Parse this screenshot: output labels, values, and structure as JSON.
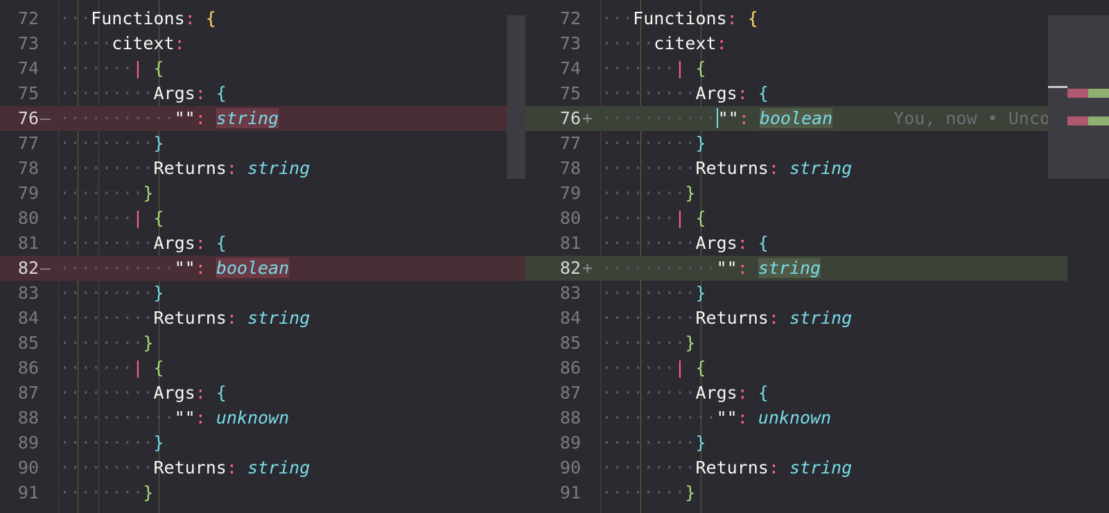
{
  "left": {
    "lines": [
      {
        "n": "72",
        "m": "",
        "d": "···",
        "parts": [
          [
            "k",
            "Functions"
          ],
          [
            "p",
            ": "
          ],
          [
            "y",
            "{"
          ]
        ]
      },
      {
        "n": "73",
        "m": "",
        "d": "·····",
        "parts": [
          [
            "k",
            "citext"
          ],
          [
            "p",
            ":"
          ]
        ]
      },
      {
        "n": "74",
        "m": "",
        "d": "·······",
        "parts": [
          [
            "bar",
            "| "
          ],
          [
            "g",
            "{"
          ]
        ]
      },
      {
        "n": "75",
        "m": "",
        "d": "·········",
        "parts": [
          [
            "k",
            "Args"
          ],
          [
            "p",
            ": "
          ],
          [
            "c",
            "{"
          ]
        ]
      },
      {
        "n": "76",
        "m": "—",
        "d": "···········",
        "bg": "del",
        "parts": [
          [
            "k",
            "\"\""
          ],
          [
            "p",
            ": "
          ],
          [
            "tw",
            "string"
          ]
        ]
      },
      {
        "n": "77",
        "m": "",
        "d": "·········",
        "parts": [
          [
            "c",
            "}"
          ]
        ]
      },
      {
        "n": "78",
        "m": "",
        "d": "·········",
        "parts": [
          [
            "k",
            "Returns"
          ],
          [
            "p",
            ": "
          ],
          [
            "t",
            "string"
          ]
        ]
      },
      {
        "n": "79",
        "m": "",
        "d": "········",
        "parts": [
          [
            "g",
            "}"
          ]
        ]
      },
      {
        "n": "80",
        "m": "",
        "d": "·······",
        "parts": [
          [
            "bar",
            "| "
          ],
          [
            "g",
            "{"
          ]
        ]
      },
      {
        "n": "81",
        "m": "",
        "d": "·········",
        "parts": [
          [
            "k",
            "Args"
          ],
          [
            "p",
            ": "
          ],
          [
            "c",
            "{"
          ]
        ]
      },
      {
        "n": "82",
        "m": "—",
        "d": "···········",
        "bg": "del",
        "parts": [
          [
            "k",
            "\"\""
          ],
          [
            "p",
            ": "
          ],
          [
            "tw",
            "boolean"
          ]
        ]
      },
      {
        "n": "83",
        "m": "",
        "d": "·········",
        "parts": [
          [
            "c",
            "}"
          ]
        ]
      },
      {
        "n": "84",
        "m": "",
        "d": "·········",
        "parts": [
          [
            "k",
            "Returns"
          ],
          [
            "p",
            ": "
          ],
          [
            "t",
            "string"
          ]
        ]
      },
      {
        "n": "85",
        "m": "",
        "d": "········",
        "parts": [
          [
            "g",
            "}"
          ]
        ]
      },
      {
        "n": "86",
        "m": "",
        "d": "·······",
        "parts": [
          [
            "bar",
            "| "
          ],
          [
            "g",
            "{"
          ]
        ]
      },
      {
        "n": "87",
        "m": "",
        "d": "·········",
        "parts": [
          [
            "k",
            "Args"
          ],
          [
            "p",
            ": "
          ],
          [
            "c",
            "{"
          ]
        ]
      },
      {
        "n": "88",
        "m": "",
        "d": "···········",
        "parts": [
          [
            "k",
            "\"\""
          ],
          [
            "p",
            ": "
          ],
          [
            "t",
            "unknown"
          ]
        ]
      },
      {
        "n": "89",
        "m": "",
        "d": "·········",
        "parts": [
          [
            "c",
            "}"
          ]
        ]
      },
      {
        "n": "90",
        "m": "",
        "d": "·········",
        "parts": [
          [
            "k",
            "Returns"
          ],
          [
            "p",
            ": "
          ],
          [
            "t",
            "string"
          ]
        ]
      },
      {
        "n": "91",
        "m": "",
        "d": "········",
        "parts": [
          [
            "g",
            "}"
          ]
        ]
      }
    ]
  },
  "right": {
    "lines": [
      {
        "n": "72",
        "m": "",
        "d": "···",
        "parts": [
          [
            "k",
            "Functions"
          ],
          [
            "p",
            ": "
          ],
          [
            "y",
            "{"
          ]
        ]
      },
      {
        "n": "73",
        "m": "",
        "d": "·····",
        "parts": [
          [
            "k",
            "citext"
          ],
          [
            "p",
            ":"
          ]
        ]
      },
      {
        "n": "74",
        "m": "",
        "d": "·······",
        "parts": [
          [
            "bar",
            "| "
          ],
          [
            "g",
            "{"
          ]
        ]
      },
      {
        "n": "75",
        "m": "",
        "d": "·········",
        "parts": [
          [
            "k",
            "Args"
          ],
          [
            "p",
            ": "
          ],
          [
            "c",
            "{"
          ]
        ]
      },
      {
        "n": "76",
        "m": "+",
        "d": "···········",
        "bg": "add",
        "parts": [
          [
            "k",
            "\"\""
          ],
          [
            "p",
            ": "
          ],
          [
            "tw",
            "boolean"
          ],
          [
            "ghost",
            "You, now • Uncom"
          ]
        ]
      },
      {
        "n": "77",
        "m": "",
        "d": "·········",
        "parts": [
          [
            "c",
            "}"
          ]
        ]
      },
      {
        "n": "78",
        "m": "",
        "d": "·········",
        "parts": [
          [
            "k",
            "Returns"
          ],
          [
            "p",
            ": "
          ],
          [
            "t",
            "string"
          ]
        ]
      },
      {
        "n": "79",
        "m": "",
        "d": "········",
        "parts": [
          [
            "g",
            "}"
          ]
        ]
      },
      {
        "n": "80",
        "m": "",
        "d": "·······",
        "parts": [
          [
            "bar",
            "| "
          ],
          [
            "g",
            "{"
          ]
        ]
      },
      {
        "n": "81",
        "m": "",
        "d": "·········",
        "parts": [
          [
            "k",
            "Args"
          ],
          [
            "p",
            ": "
          ],
          [
            "c",
            "{"
          ]
        ]
      },
      {
        "n": "82",
        "m": "+",
        "d": "···········",
        "bg": "add",
        "parts": [
          [
            "k",
            "\"\""
          ],
          [
            "p",
            ": "
          ],
          [
            "tw",
            "string"
          ]
        ]
      },
      {
        "n": "83",
        "m": "",
        "d": "·········",
        "parts": [
          [
            "c",
            "}"
          ]
        ]
      },
      {
        "n": "84",
        "m": "",
        "d": "·········",
        "parts": [
          [
            "k",
            "Returns"
          ],
          [
            "p",
            ": "
          ],
          [
            "t",
            "string"
          ]
        ]
      },
      {
        "n": "85",
        "m": "",
        "d": "········",
        "parts": [
          [
            "g",
            "}"
          ]
        ]
      },
      {
        "n": "86",
        "m": "",
        "d": "·······",
        "parts": [
          [
            "bar",
            "| "
          ],
          [
            "g",
            "{"
          ]
        ]
      },
      {
        "n": "87",
        "m": "",
        "d": "·········",
        "parts": [
          [
            "k",
            "Args"
          ],
          [
            "p",
            ": "
          ],
          [
            "c",
            "{"
          ]
        ]
      },
      {
        "n": "88",
        "m": "",
        "d": "···········",
        "parts": [
          [
            "k",
            "\"\""
          ],
          [
            "p",
            ": "
          ],
          [
            "t",
            "unknown"
          ]
        ]
      },
      {
        "n": "89",
        "m": "",
        "d": "·········",
        "parts": [
          [
            "c",
            "}"
          ]
        ]
      },
      {
        "n": "90",
        "m": "",
        "d": "·········",
        "parts": [
          [
            "k",
            "Returns"
          ],
          [
            "p",
            ": "
          ],
          [
            "t",
            "string"
          ]
        ]
      },
      {
        "n": "91",
        "m": "",
        "d": "········",
        "parts": [
          [
            "g",
            "}"
          ]
        ]
      }
    ]
  },
  "colors": {
    "background": "#2b2a30",
    "deleted_line": "#4a2e35",
    "added_line": "#3b4237",
    "keyword_pink": "#ff6188",
    "type_cyan": "#78dce8",
    "brace_green": "#a9dc76",
    "brace_yellow": "#ffd866"
  }
}
